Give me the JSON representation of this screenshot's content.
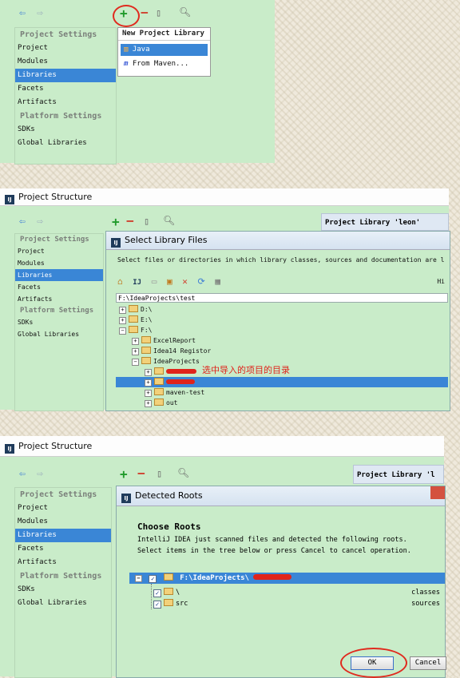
{
  "panel1": {
    "sidebar_heading_project": "Project Settings",
    "sidebar_items_project": [
      "Project",
      "Modules",
      "Libraries",
      "Facets",
      "Artifacts"
    ],
    "sidebar_heading_platform": "Platform Settings",
    "sidebar_items_platform": [
      "SDKs",
      "Global Libraries"
    ],
    "popup_title": "New Project Library",
    "popup_items": [
      "Java",
      "From Maven..."
    ],
    "popup_maven_letter": "m"
  },
  "panel2": {
    "window_title": "Project Structure",
    "logo_text": "IJ",
    "sidebar_heading_project": "Project Settings",
    "sidebar_items_project": [
      "Project",
      "Modules",
      "Libraries",
      "Facets",
      "Artifacts"
    ],
    "sidebar_heading_platform": "Platform Settings",
    "sidebar_items_platform": [
      "SDKs",
      "Global Libraries"
    ],
    "right_header": "Project Library 'leon'",
    "dialog_title": "Select Library Files",
    "instruction": "Select files or directories in which library classes, sources and documentation are l",
    "hide_path_label": "Hi",
    "path_value": "F:\\IdeaProjects\\test",
    "tree": [
      "D:\\",
      "E:\\",
      "F:\\",
      "ExcelReport",
      "Idea14 Registor",
      "IdeaProjects",
      "maven-test",
      "out"
    ],
    "annotation": "选中导入的项目的目录"
  },
  "panel3": {
    "window_title": "Project Structure",
    "logo_text": "IJ",
    "sidebar_heading_project": "Project Settings",
    "sidebar_items_project": [
      "Project",
      "Modules",
      "Libraries",
      "Facets",
      "Artifacts"
    ],
    "sidebar_heading_platform": "Platform Settings",
    "sidebar_items_platform": [
      "SDKs",
      "Global Libraries"
    ],
    "right_header": "Project Library 'l",
    "dialog_title": "Detected Roots",
    "heading": "Choose Roots",
    "description_line1": "IntelliJ IDEA just scanned files and detected the following roots.",
    "description_line2": "Select items in the tree below or press Cancel to cancel operation.",
    "root_path": "F:\\IdeaProjects\\",
    "children": [
      {
        "name": "\\",
        "kind": "classes"
      },
      {
        "name": "src",
        "kind": "sources"
      }
    ],
    "ok_label": "OK",
    "cancel_label": "Cancel"
  },
  "colors": {
    "accent_green": "#1f9a2a",
    "accent_red": "#d0402e",
    "selection_blue": "#3a86d6",
    "highlight_red": "#e0241b"
  }
}
